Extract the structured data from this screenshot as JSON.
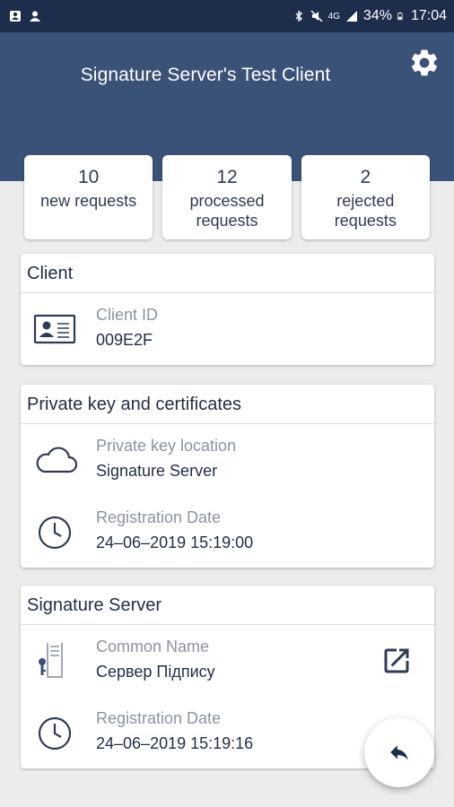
{
  "status_bar": {
    "time": "17:04",
    "battery": "34%",
    "network": "4G"
  },
  "header": {
    "title": "Signature Server's Test Client"
  },
  "stats": [
    {
      "count": "10",
      "label": "new requests"
    },
    {
      "count": "12",
      "label": "processed requests"
    },
    {
      "count": "2",
      "label": "rejected requests"
    }
  ],
  "client_card": {
    "title": "Client",
    "rows": [
      {
        "label": "Client ID",
        "value": "009E2F",
        "icon": "id-card-icon"
      }
    ]
  },
  "key_card": {
    "title": "Private key and certificates",
    "rows": [
      {
        "label": "Private key location",
        "value": "Signature Server",
        "icon": "cloud-icon"
      },
      {
        "label": "Registration Date",
        "value": "24–06–2019 15:19:00",
        "icon": "clock-icon"
      }
    ]
  },
  "server_card": {
    "title": "Signature Server",
    "rows": [
      {
        "label": "Common Name",
        "value": "Сервер Підпису",
        "icon": "server-key-icon"
      },
      {
        "label": "Registration Date",
        "value": "24–06–2019 15:19:16",
        "icon": "clock-icon"
      }
    ]
  },
  "colors": {
    "header_bg": "#3b5278",
    "status_bg": "#1d2e4c",
    "text_primary": "#1f2d45",
    "text_secondary": "#8a93a3"
  }
}
